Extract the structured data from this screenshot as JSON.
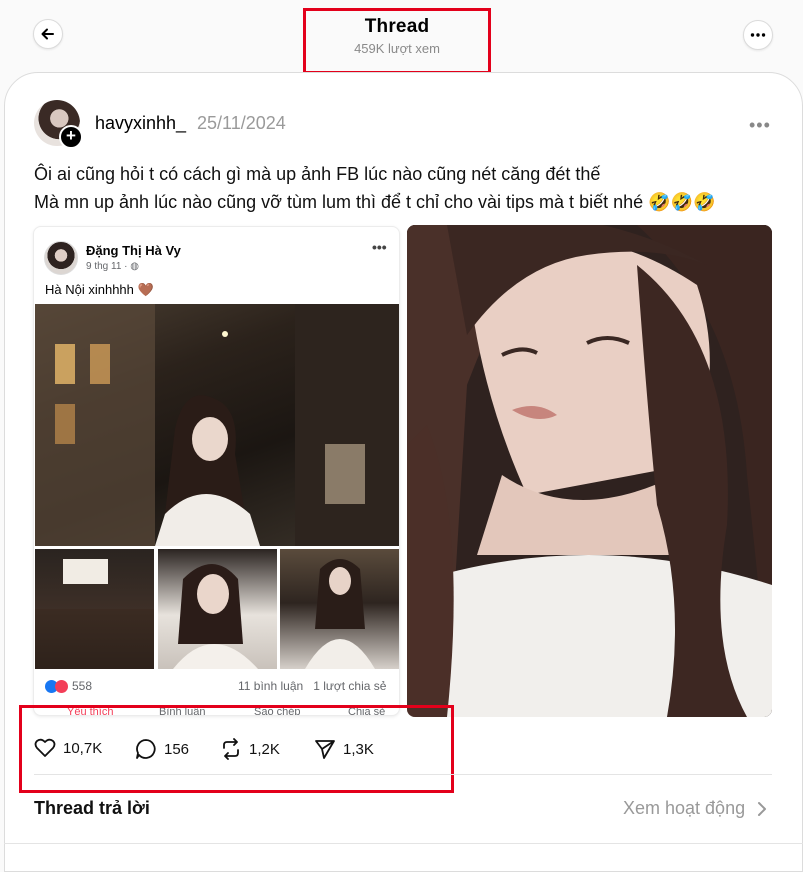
{
  "header": {
    "title": "Thread",
    "views": "459K lượt xem",
    "back_icon": "arrow-left-icon",
    "more_icon": "more-horizontal-icon"
  },
  "post": {
    "username": "havyxinhh_",
    "date": "25/11/2024",
    "text_line1": "Ôi ai cũng hỏi t có cách gì mà up ảnh FB lúc nào cũng nét căng đét thế",
    "text_line2": "Mà mn up ảnh lúc nào cũng vỡ tùm lum thì để t chỉ cho vài tips mà t biết nhé 🤣🤣🤣",
    "more_label": "•••"
  },
  "fb_screenshot": {
    "name": "Đặng Thị Hà Vy",
    "time": "9 thg 11 · ",
    "caption": "Hà Nội xinhhhh 🤎",
    "more_label": "•••",
    "reaction_count": "558",
    "comments": "11 bình luận",
    "shares": "1 lượt chia sẻ",
    "actions": [
      "Yêu thích",
      "Bình luận",
      "Sao chép",
      "Chia sẻ"
    ]
  },
  "actions": {
    "likes": "10,7K",
    "comments": "156",
    "reposts": "1,2K",
    "shares": "1,3K"
  },
  "replies": {
    "label": "Thread trả lời",
    "activity_link": "Xem hoạt động"
  },
  "colors": {
    "highlight": "#e3001b",
    "muted_text": "#9a9a9a"
  }
}
